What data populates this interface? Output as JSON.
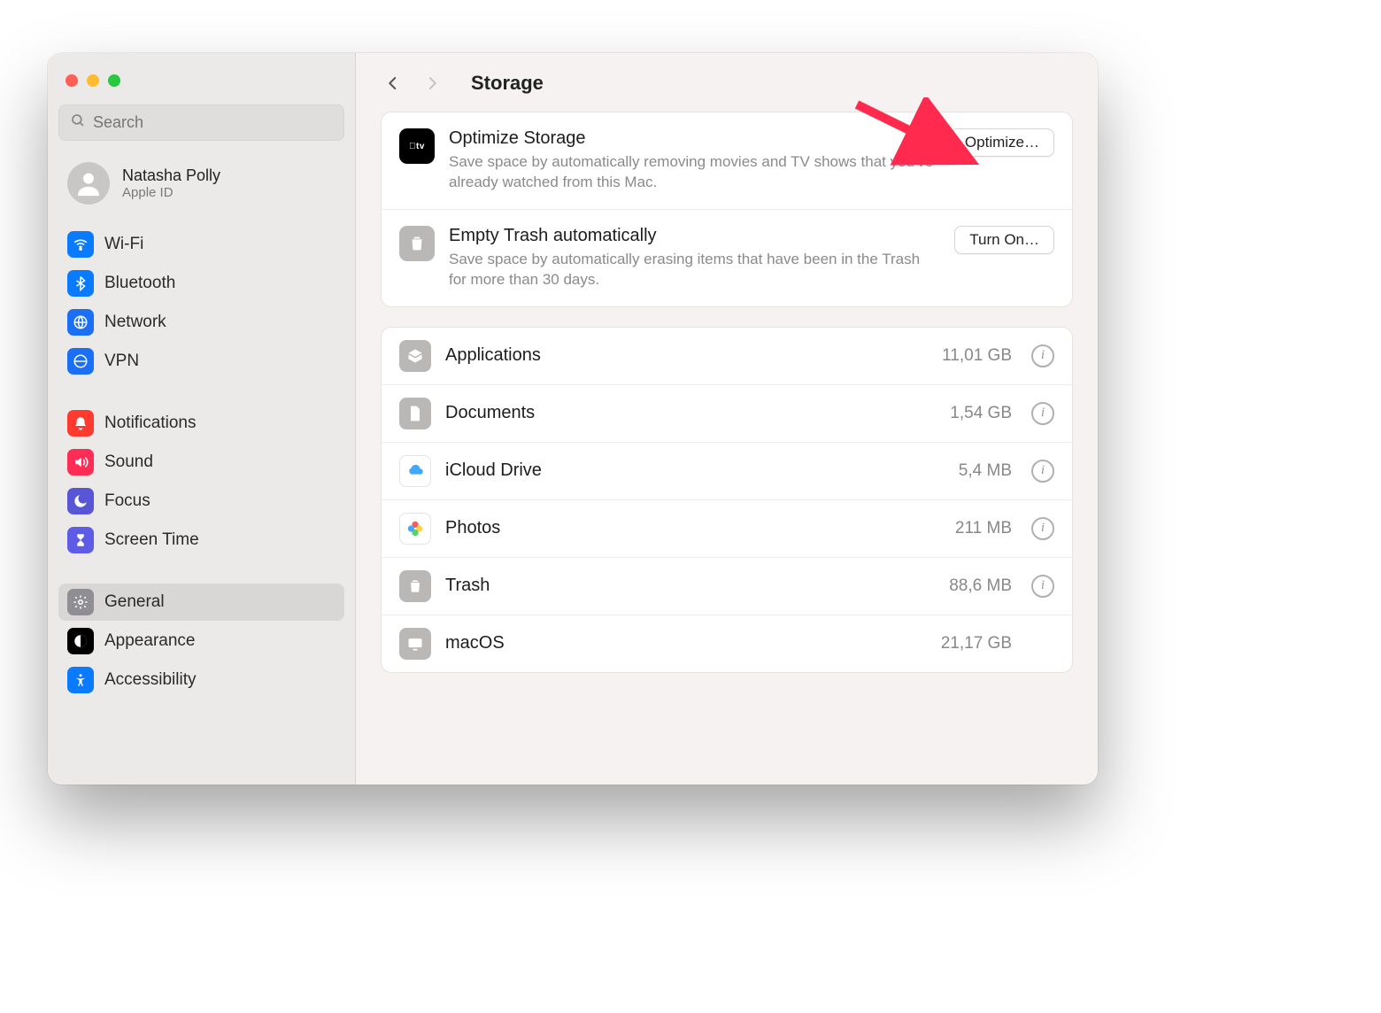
{
  "search": {
    "placeholder": "Search"
  },
  "account": {
    "name": "Natasha Polly",
    "sub": "Apple ID"
  },
  "sidebar": {
    "items": [
      {
        "label": "Wi-Fi",
        "icon": "wifi-icon",
        "color": "ic-blue"
      },
      {
        "label": "Bluetooth",
        "icon": "bluetooth-icon",
        "color": "ic-blue"
      },
      {
        "label": "Network",
        "icon": "network-icon",
        "color": "ic-blue2"
      },
      {
        "label": "VPN",
        "icon": "vpn-icon",
        "color": "ic-blue2"
      },
      {
        "label": "Notifications",
        "icon": "bell-icon",
        "color": "ic-red"
      },
      {
        "label": "Sound",
        "icon": "speaker-icon",
        "color": "ic-pink"
      },
      {
        "label": "Focus",
        "icon": "moon-icon",
        "color": "ic-purple"
      },
      {
        "label": "Screen Time",
        "icon": "hourglass-icon",
        "color": "ic-indigo"
      },
      {
        "label": "General",
        "icon": "gear-icon",
        "color": "ic-gray",
        "selected": true
      },
      {
        "label": "Appearance",
        "icon": "contrast-icon",
        "color": "ic-black"
      },
      {
        "label": "Accessibility",
        "icon": "accessibility-icon",
        "color": "ic-blue"
      }
    ]
  },
  "header": {
    "title": "Storage"
  },
  "recommendations": [
    {
      "id": "optimize-storage",
      "title": "Optimize Storage",
      "desc": "Save space by automatically removing movies and TV shows that you've already watched from this Mac.",
      "button": "Optimize…",
      "icon": "apple-tv-icon"
    },
    {
      "id": "empty-trash-auto",
      "title": "Empty Trash automatically",
      "desc": "Save space by automatically erasing items that have been in the Trash for more than 30 days.",
      "button": "Turn On…",
      "icon": "trash-icon"
    }
  ],
  "categories": [
    {
      "label": "Applications",
      "size": "11,01 GB",
      "icon": "apps-icon",
      "info": true
    },
    {
      "label": "Documents",
      "size": "1,54 GB",
      "icon": "doc-icon",
      "info": true
    },
    {
      "label": "iCloud Drive",
      "size": "5,4 MB",
      "icon": "icloud-icon",
      "info": true,
      "white": true
    },
    {
      "label": "Photos",
      "size": "211 MB",
      "icon": "photos-icon",
      "info": true,
      "white": true
    },
    {
      "label": "Trash",
      "size": "88,6 MB",
      "icon": "trash-icon",
      "info": true
    },
    {
      "label": "macOS",
      "size": "21,17 GB",
      "icon": "macos-icon",
      "info": false
    }
  ],
  "annotation": {
    "points_to": "optimize-button",
    "color": "#ff2a4d"
  }
}
